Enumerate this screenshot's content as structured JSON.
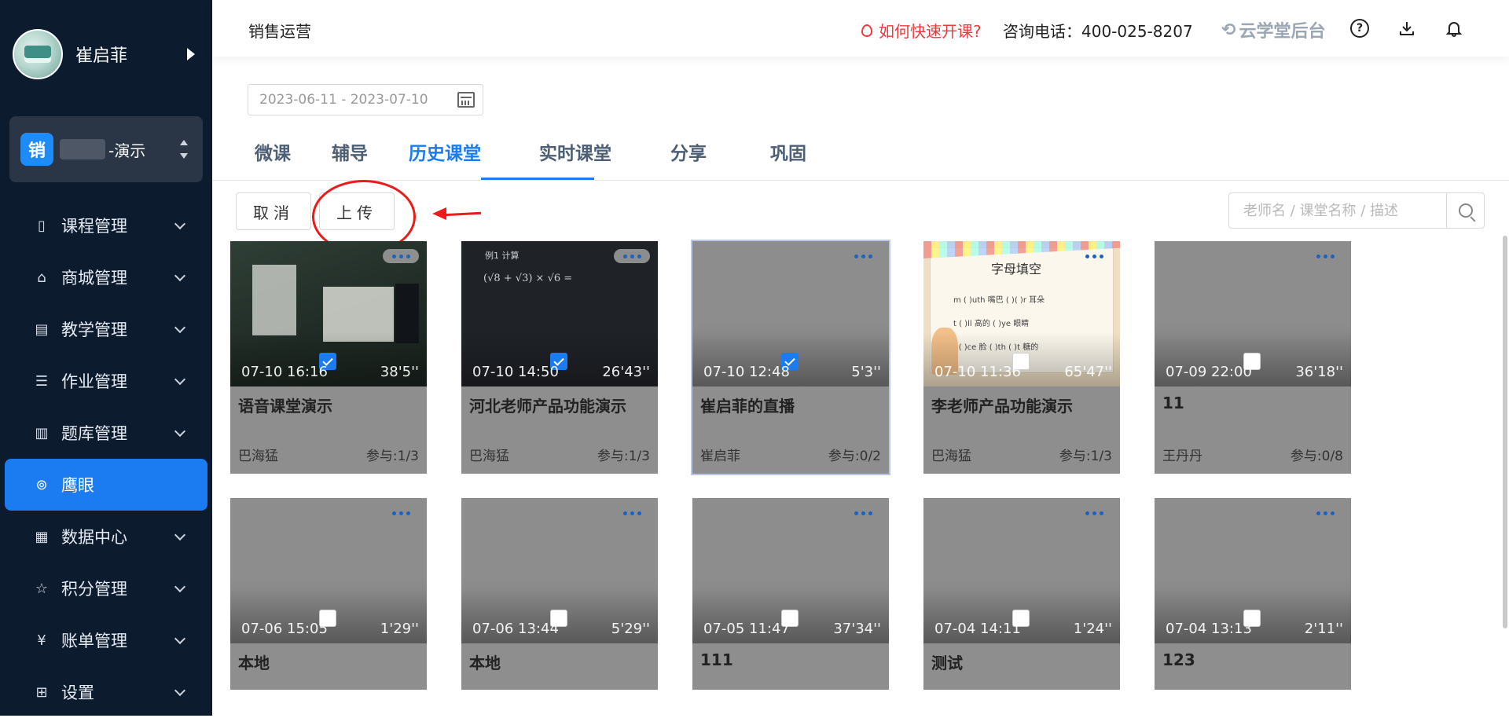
{
  "sidebar": {
    "user_name": "崔启菲",
    "org_badge": "销",
    "org_name": "-演示",
    "items": [
      {
        "label": "课程管理",
        "icon": "book-icon",
        "glyph": "▯"
      },
      {
        "label": "商城管理",
        "icon": "shop-icon",
        "glyph": "⌂"
      },
      {
        "label": "教学管理",
        "icon": "teaching-icon",
        "glyph": "▤"
      },
      {
        "label": "作业管理",
        "icon": "homework-icon",
        "glyph": "☰"
      },
      {
        "label": "题库管理",
        "icon": "question-bank-icon",
        "glyph": "▥"
      },
      {
        "label": "鹰眼",
        "icon": "eagle-eye-icon",
        "glyph": "⊚"
      },
      {
        "label": "数据中心",
        "icon": "chart-icon",
        "glyph": "▦"
      },
      {
        "label": "积分管理",
        "icon": "star-icon",
        "glyph": "☆"
      },
      {
        "label": "账单管理",
        "icon": "bill-icon",
        "glyph": "¥"
      },
      {
        "label": "设置",
        "icon": "settings-icon",
        "glyph": "⊞"
      }
    ],
    "active_index": 5
  },
  "header": {
    "title": "销售运营",
    "help_link": "如何快速开课?",
    "phone": "咨询电话：400-025-8207",
    "brand": "云学堂后台"
  },
  "filter": {
    "date_range": "2023-06-11 - 2023-07-10"
  },
  "tabs": [
    "微课",
    "辅导",
    "历史课堂",
    "实时课堂",
    "分享",
    "巩固"
  ],
  "active_tab": 2,
  "actions": {
    "cancel": "取消",
    "upload": "上传"
  },
  "search": {
    "placeholder": "老师名 / 课堂名称 / 描述"
  },
  "cards_row1": [
    {
      "time": "07-10 16:16",
      "duration": "38'5''",
      "title": "语音课堂演示",
      "teacher": "巴海猛",
      "participation": "参与:1/3",
      "checked": true
    },
    {
      "time": "07-10 14:50",
      "duration": "26'43''",
      "title": "河北老师产品功能演示",
      "teacher": "巴海猛",
      "participation": "参与:1/3",
      "checked": true
    },
    {
      "time": "07-10 12:48",
      "duration": "5'3''",
      "title": "崔启菲的直播",
      "teacher": "崔启菲",
      "participation": "参与:0/2",
      "checked": true
    },
    {
      "time": "07-10 11:36",
      "duration": "65'47''",
      "title": "李老师产品功能演示",
      "teacher": "巴海猛",
      "participation": "参与:1/3",
      "checked": false
    },
    {
      "time": "07-09 22:00",
      "duration": "36'18''",
      "title": "11",
      "teacher": "王丹丹",
      "participation": "参与:0/8",
      "checked": false
    }
  ],
  "cards_row2": [
    {
      "time": "07-06 15:05",
      "duration": "1'29''",
      "title": "本地",
      "checked": false
    },
    {
      "time": "07-06 13:44",
      "duration": "5'29''",
      "title": "本地",
      "checked": false
    },
    {
      "time": "07-05 11:47",
      "duration": "37'34''",
      "title": "111",
      "checked": false
    },
    {
      "time": "07-04 14:11",
      "duration": "1'24''",
      "title": "测试",
      "checked": false
    },
    {
      "time": "07-04 13:13",
      "duration": "2'11''",
      "title": "123",
      "checked": false
    }
  ],
  "thumb_text": {
    "board_line1": "例1 计算",
    "board_line2": "(√8 + √3) × √6 =",
    "poster_title": "字母填空",
    "poster_lines": [
      "m ( )uth 嘴巴   ( )( )r 耳朵",
      "t ( )ll 高的    ( )ye 眼睛",
      "f ( )ce 脸     ( )th ( )t 糖的"
    ]
  },
  "colors": {
    "sidebar_bg": "#0d1b2f",
    "accent": "#1a7cf0",
    "alert": "#f0393d"
  }
}
